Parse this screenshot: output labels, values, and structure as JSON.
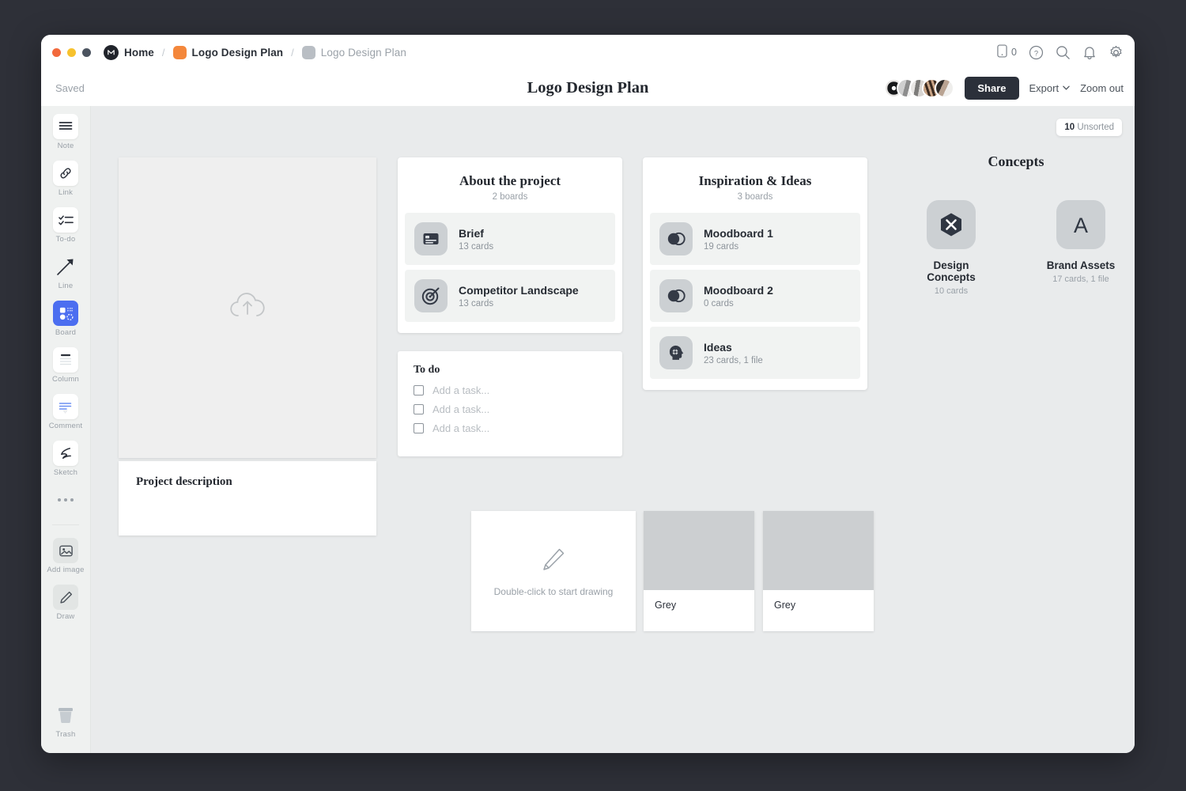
{
  "window": {
    "traffic_lights": [
      "close",
      "minimize",
      "zoom"
    ]
  },
  "titlebar": {
    "breadcrumbs": [
      {
        "label": "Home",
        "icon": "milanote-home-icon",
        "muted": false
      },
      {
        "label": "Logo Design Plan",
        "icon": "orange-board-icon",
        "muted": false
      },
      {
        "label": "Logo Design Plan",
        "icon": "grey-board-icon",
        "muted": true
      }
    ],
    "separator": "/",
    "device_count": "0",
    "icons": [
      "mobile-icon",
      "help-icon",
      "search-icon",
      "notifications-icon",
      "settings-icon"
    ]
  },
  "subbar": {
    "saved_status": "Saved",
    "doc_title": "Logo Design Plan",
    "share_label": "Share",
    "export_label": "Export",
    "zoom_label": "Zoom out",
    "avatar_count": 5
  },
  "toolbar": {
    "items": [
      {
        "label": "Note",
        "icon": "note-icon",
        "style": "white",
        "active": false
      },
      {
        "label": "Link",
        "icon": "link-icon",
        "style": "white",
        "active": false
      },
      {
        "label": "To-do",
        "icon": "todo-icon",
        "style": "white",
        "active": false
      },
      {
        "label": "Line",
        "icon": "line-arrow-icon",
        "style": "plain",
        "active": false
      },
      {
        "label": "Board",
        "icon": "board-icon",
        "style": "active",
        "active": true
      },
      {
        "label": "Column",
        "icon": "column-icon",
        "style": "white",
        "active": false
      },
      {
        "label": "Comment",
        "icon": "comment-icon",
        "style": "white",
        "active": false
      },
      {
        "label": "Sketch",
        "icon": "sketch-icon",
        "style": "white",
        "active": false
      }
    ],
    "more_label": "more-options",
    "secondary": [
      {
        "label": "Add image",
        "icon": "add-image-icon",
        "style": "grey"
      },
      {
        "label": "Draw",
        "icon": "draw-pencil-icon",
        "style": "grey"
      }
    ],
    "trash": {
      "label": "Trash",
      "icon": "trash-icon"
    }
  },
  "canvas": {
    "unsorted_badge": {
      "count": "10",
      "label": "Unsorted"
    },
    "upload_card": {
      "icon": "cloud-upload-icon"
    },
    "description_card": {
      "title": "Project description"
    },
    "groups": [
      {
        "title": "About the project",
        "subtitle": "2 boards",
        "boards": [
          {
            "name": "Brief",
            "count": "13 cards",
            "icon": "brief-card-icon"
          },
          {
            "name": "Competitor Landscape",
            "count": "13 cards",
            "icon": "target-icon"
          }
        ]
      },
      {
        "title": "Inspiration & Ideas",
        "subtitle": "3 boards",
        "boards": [
          {
            "name": "Moodboard 1",
            "count": "19 cards",
            "icon": "overlap-circles-icon"
          },
          {
            "name": "Moodboard 2",
            "count": "0 cards",
            "icon": "overlap-circles-icon"
          },
          {
            "name": "Ideas",
            "count": "23 cards, 1 file",
            "icon": "head-gear-icon"
          }
        ]
      }
    ],
    "todo_card": {
      "title": "To do",
      "tasks": [
        {
          "placeholder": "Add a task...",
          "checked": false
        },
        {
          "placeholder": "Add a task...",
          "checked": false
        },
        {
          "placeholder": "Add a task...",
          "checked": false
        }
      ]
    },
    "concepts": {
      "title": "Concepts",
      "items": [
        {
          "name": "Design Concepts",
          "count": "10 cards",
          "icon": "hexagon-x-icon"
        },
        {
          "name": "Brand Assets",
          "count": "17 cards, 1 file",
          "icon": "letter-a-icon"
        }
      ]
    },
    "drawing_card": {
      "text": "Double-click to start drawing",
      "icon": "pencil-icon"
    },
    "image_cards": [
      {
        "caption": "Grey"
      },
      {
        "caption": "Grey"
      }
    ]
  },
  "colors": {
    "accent_blue": "#4c6ef0",
    "brand_orange": "#f4873b",
    "dark": "#2b303a",
    "canvas_bg": "#e9ebec",
    "toolbar_bg": "#eff1f0",
    "desktop_bg": "#2e3038"
  }
}
